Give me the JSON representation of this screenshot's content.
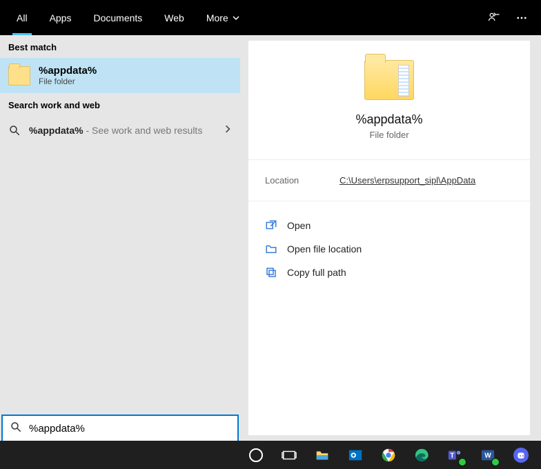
{
  "topbar": {
    "tabs": [
      {
        "label": "All",
        "active": true
      },
      {
        "label": "Apps"
      },
      {
        "label": "Documents"
      },
      {
        "label": "Web"
      },
      {
        "label": "More",
        "dropdown": true
      }
    ]
  },
  "left": {
    "best_match_header": "Best match",
    "result": {
      "title": "%appdata%",
      "subtitle": "File folder"
    },
    "web_header": "Search work and web",
    "web_result": {
      "query": "%appdata%",
      "hint": " - See work and web results"
    }
  },
  "details": {
    "title": "%appdata%",
    "subtitle": "File folder",
    "location_label": "Location",
    "location_value": "C:\\Users\\erpsupport_sipl\\AppData",
    "actions": [
      {
        "label": "Open",
        "icon": "open"
      },
      {
        "label": "Open file location",
        "icon": "folder"
      },
      {
        "label": "Copy full path",
        "icon": "copy"
      }
    ]
  },
  "search": {
    "value": "%appdata%"
  },
  "taskbar_icons": [
    "cortana",
    "task-view",
    "file-explorer",
    "outlook",
    "chrome",
    "edge",
    "teams",
    "word",
    "discord"
  ]
}
